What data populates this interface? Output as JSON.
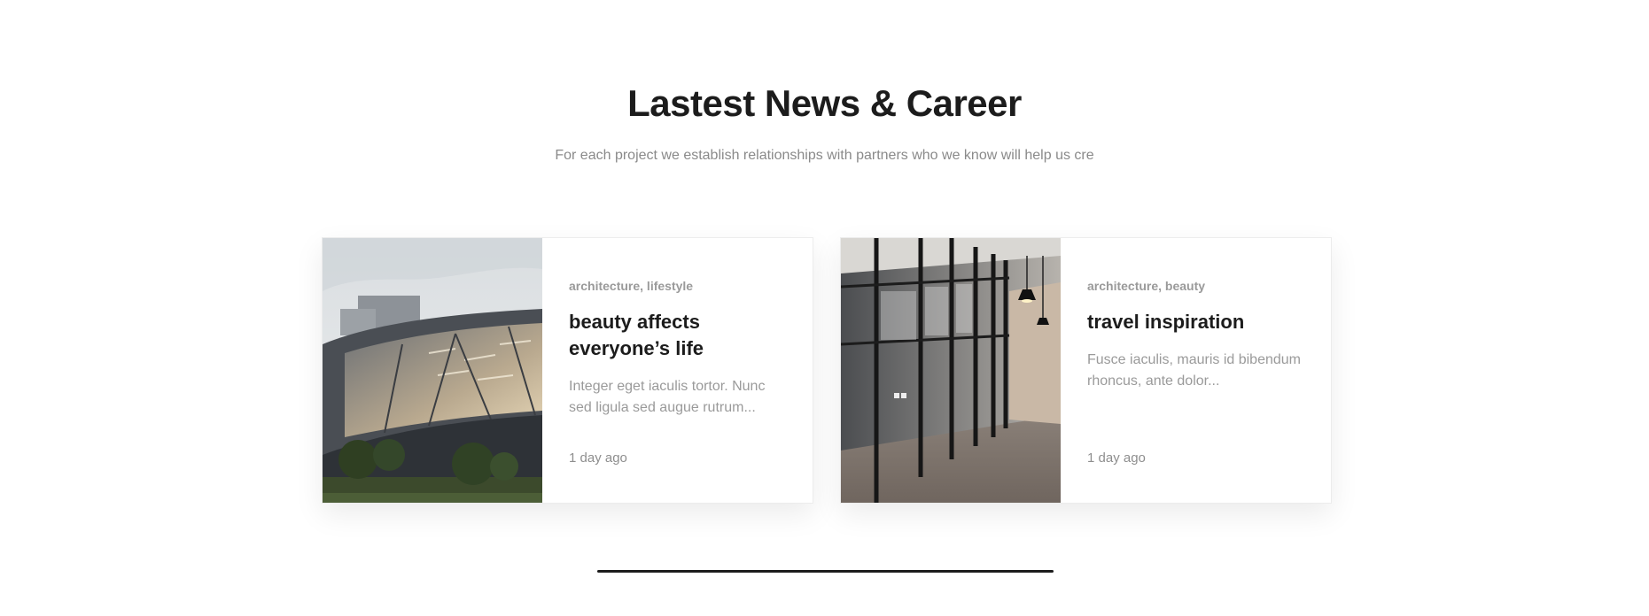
{
  "section": {
    "title": "Lastest News & Career",
    "subtitle": "For each project we establish relationships with partners who we know will help us cre"
  },
  "posts": [
    {
      "image_icon": "building-architecture-photo",
      "tags": "architecture, lifestyle",
      "title": "beauty affects everyone’s life",
      "excerpt": "Integer eget iaculis tortor. Nunc sed ligula sed augue rutrum...",
      "date": "1 day ago"
    },
    {
      "image_icon": "office-corridor-photo",
      "tags": "architecture, beauty",
      "title": "travel inspiration",
      "excerpt": "Fusce iaculis, mauris id bibendum rhoncus, ante dolor...",
      "date": "1 day ago"
    }
  ],
  "colors": {
    "heading": "#1c1c1c",
    "muted": "#9a9a9a",
    "divider": "#1c1c1c"
  }
}
